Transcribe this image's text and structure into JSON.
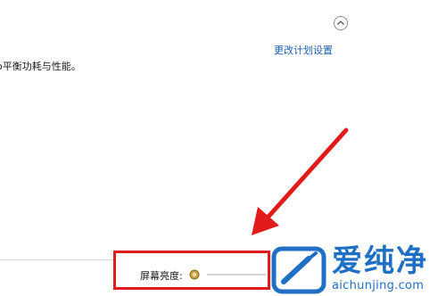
{
  "plan": {
    "description": "o平衡功耗与性能。",
    "change_settings_link": "更改计划设置"
  },
  "display": {
    "brightness_label": "屏幕亮度:",
    "brightness_icon": "sun-icon"
  },
  "annotation": {
    "highlight_color": "#e11b1b",
    "arrow_color": "#e11b1b"
  },
  "watermark": {
    "title": "爱纯净",
    "url": "aichunjing.com",
    "color": "#1f6fc4"
  },
  "icons": {
    "collapse": "chevron-up-icon"
  }
}
